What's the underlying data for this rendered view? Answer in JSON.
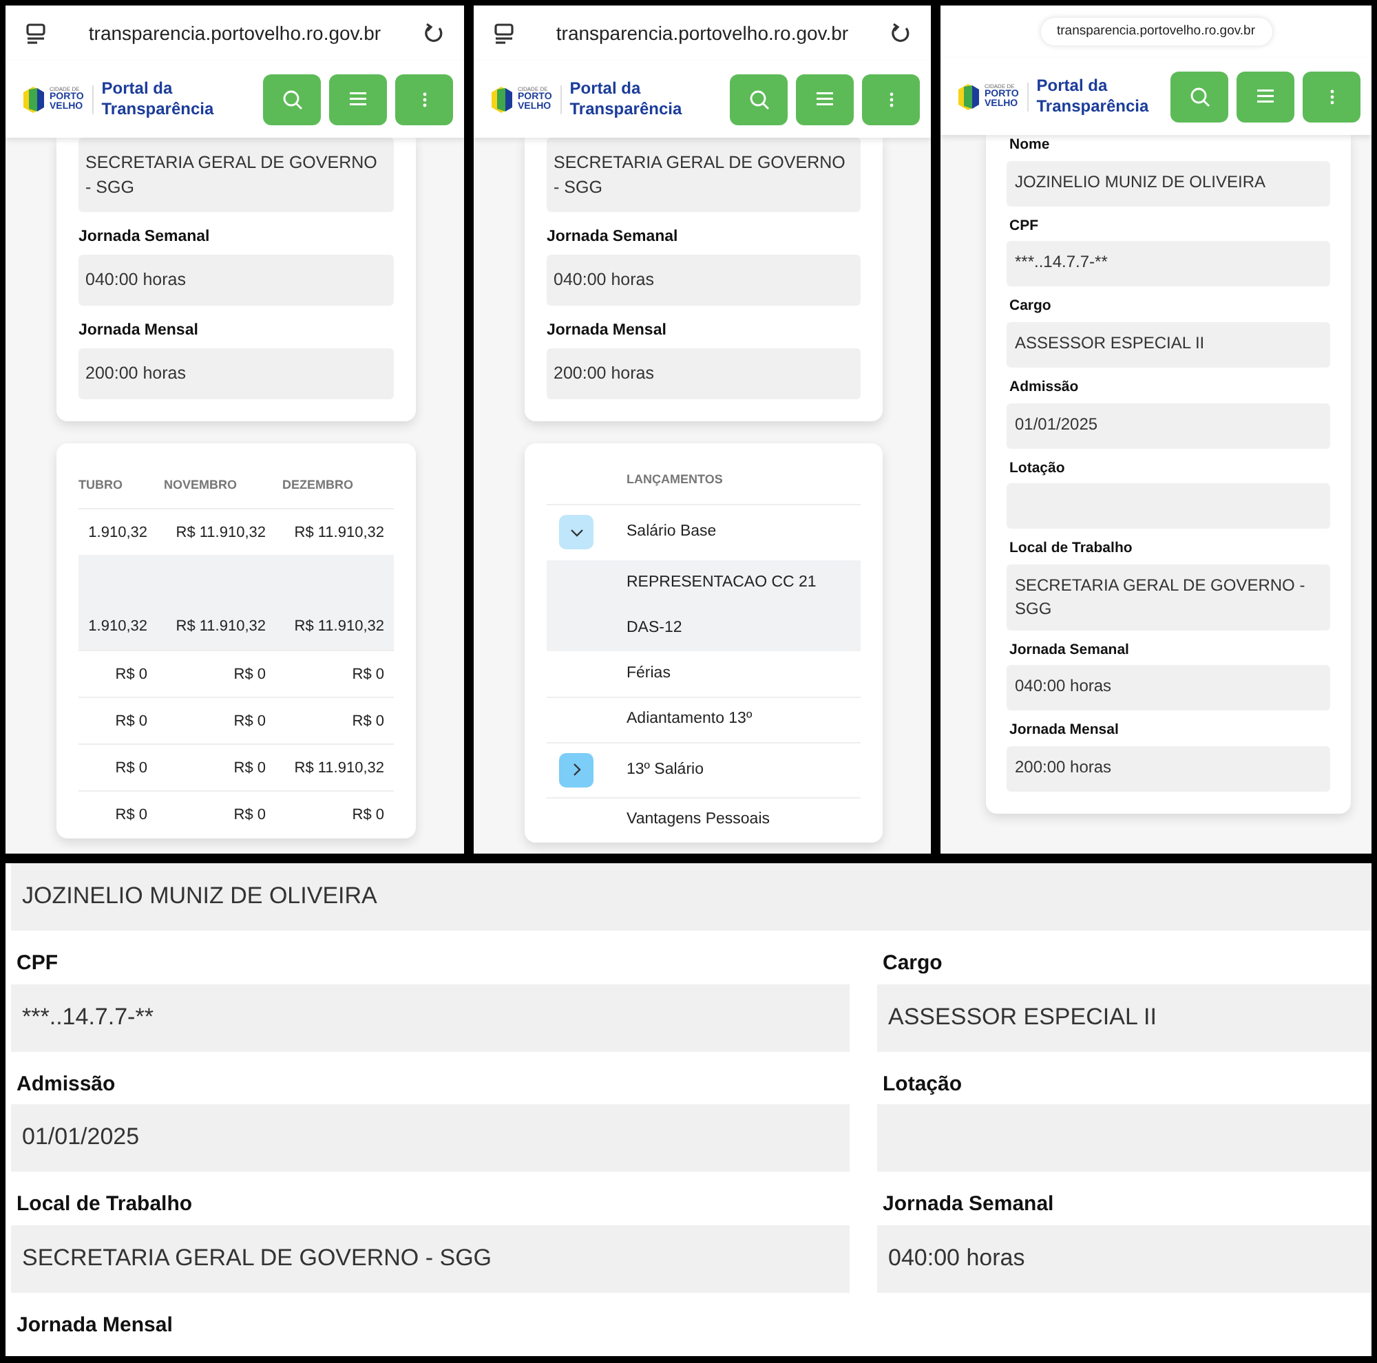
{
  "panels": [
    {
      "kind": "phone",
      "address_bar": {
        "kind": "full",
        "url": "transparencia.portovelho.ro.gov.br"
      },
      "header": {
        "logo_text": [
          "CIDADE DE",
          "PORTO",
          "VELHO"
        ],
        "title": [
          "Portal da",
          "Transparência"
        ]
      },
      "sections": [
        {
          "kind": "fields",
          "fields": [
            {
              "value": "SECRETARIA GERAL DE GOVERNO - SGG"
            },
            {
              "label": "Jornada Semanal",
              "value": "040:00 horas"
            },
            {
              "label": "Jornada Mensal",
              "value": "200:00 horas"
            }
          ]
        },
        {
          "kind": "table",
          "columns": [
            "TUBRO",
            "NOVEMBRO",
            "DEZEMBRO"
          ],
          "rows": [
            {
              "highlighted": false,
              "cells": [
                "1.910,32",
                "R$ 11.910,32",
                "R$ 11.910,32"
              ]
            },
            {
              "highlighted": true,
              "cells": []
            },
            {
              "highlighted": true,
              "cells": [
                "1.910,32",
                "R$ 11.910,32",
                "R$ 11.910,32"
              ]
            },
            {
              "highlighted": false,
              "cells": [
                "R$ 0",
                "R$ 0",
                "R$ 0"
              ]
            },
            {
              "highlighted": false,
              "cells": [
                "R$ 0",
                "R$ 0",
                "R$ 0"
              ]
            },
            {
              "highlighted": false,
              "cells": [
                "R$ 0",
                "R$ 0",
                "R$ 11.910,32"
              ]
            },
            {
              "highlighted": false,
              "cells": [
                "R$ 0",
                "R$ 0",
                "R$ 0"
              ]
            }
          ]
        }
      ]
    },
    {
      "kind": "phone",
      "address_bar": {
        "kind": "full",
        "url": "transparencia.portovelho.ro.gov.br"
      },
      "header": {
        "logo_text": [
          "CIDADE DE",
          "PORTO",
          "VELHO"
        ],
        "title": [
          "Portal da",
          "Transparência"
        ]
      },
      "sections": [
        {
          "kind": "fields",
          "fields": [
            {
              "value": "SECRETARIA GERAL DE GOVERNO - SGG"
            },
            {
              "label": "Jornada Semanal",
              "value": "040:00 horas"
            },
            {
              "label": "Jornada Mensal",
              "value": "200:00 horas"
            }
          ]
        },
        {
          "kind": "list",
          "heading": "LANÇAMENTOS",
          "rows": [
            {
              "kind": "expandable",
              "expanded": true,
              "label": "Salário Base"
            },
            {
              "kind": "sub",
              "label": "REPRESENTACAO CC 21"
            },
            {
              "kind": "sub",
              "label": "DAS-12"
            },
            {
              "kind": "plain",
              "label": "Férias"
            },
            {
              "kind": "plain",
              "label": "Adiantamento 13º"
            },
            {
              "kind": "expandable",
              "expanded": false,
              "label": "13º Salário"
            },
            {
              "kind": "plain",
              "label": "Vantagens Pessoais"
            }
          ]
        }
      ]
    },
    {
      "kind": "phone",
      "address_bar": {
        "kind": "compact",
        "url": "transparencia.portovelho.ro.gov.br"
      },
      "header": {
        "logo_text": [
          "CIDADE DE",
          "PORTO",
          "VELHO"
        ],
        "title": [
          "Portal da",
          "Transparência"
        ]
      },
      "sections": [
        {
          "kind": "fields",
          "fields": [
            {
              "label": "Nome",
              "value": "JOZINELIO MUNIZ DE OLIVEIRA"
            },
            {
              "label": "CPF",
              "value": "***..14.7.7-**"
            },
            {
              "label": "Cargo",
              "value": "ASSESSOR ESPECIAL II"
            },
            {
              "label": "Admissão",
              "value": "01/01/2025"
            },
            {
              "label": "Lotação"
            },
            {
              "label": "Local de Trabalho",
              "value": "SECRETARIA GERAL DE GOVERNO - SGG"
            },
            {
              "label": "Jornada Semanal",
              "value": "040:00 horas"
            },
            {
              "label": "Jornada Mensal",
              "value": "200:00 horas"
            }
          ]
        }
      ]
    },
    {
      "kind": "desktop",
      "fields": [
        {
          "wide": true,
          "value": "JOZINELIO MUNIZ DE OLIVEIRA"
        },
        {
          "wide": false,
          "label": "CPF",
          "value": "***..14.7.7-**"
        },
        {
          "wide": false,
          "label": "Cargo",
          "value": "ASSESSOR ESPECIAL II"
        },
        {
          "wide": false,
          "label": "Admissão",
          "value": "01/01/2025"
        },
        {
          "wide": false,
          "label": "Lotação"
        },
        {
          "wide": false,
          "label": "Local de Trabalho",
          "value": "SECRETARIA GERAL DE GOVERNO - SGG"
        },
        {
          "wide": false,
          "label": "Jornada Semanal",
          "value": "040:00 horas"
        }
      ],
      "trailing_label": "Jornada Mensal"
    }
  ]
}
